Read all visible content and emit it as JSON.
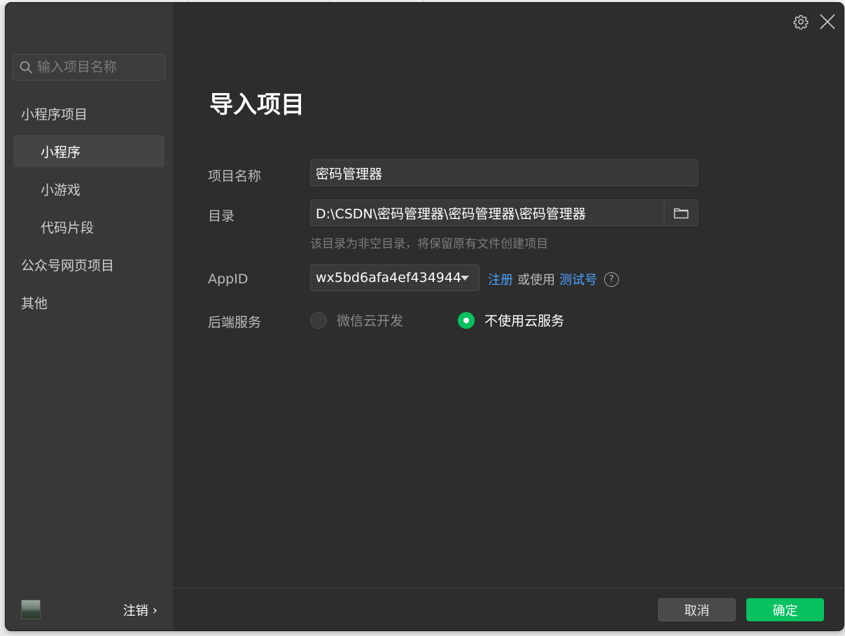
{
  "sidebar": {
    "search_placeholder": "输入项目名称",
    "groups": [
      {
        "label": "小程序项目"
      },
      {
        "label": "小程序"
      },
      {
        "label": "小游戏"
      },
      {
        "label": "代码片段"
      },
      {
        "label": "公众号网页项目"
      },
      {
        "label": "其他"
      }
    ],
    "footer": {
      "logout_label": "注销",
      "logout_arrow": "›"
    }
  },
  "main": {
    "title": "导入项目",
    "project_name": {
      "label": "项目名称",
      "value": "密码管理器"
    },
    "directory": {
      "label": "目录",
      "value": "D:\\CSDN\\密码管理器\\密码管理器\\密码管理器",
      "hint": "该目录为非空目录，将保留原有文件创建项目"
    },
    "appid": {
      "label": "AppID",
      "value": "wx5bd6afa4ef434944",
      "register_link": "注册",
      "or_use": "或使用",
      "test_link": "测试号",
      "help_glyph": "?"
    },
    "backend": {
      "label": "后端服务",
      "options": [
        {
          "label": "微信云开发",
          "checked": false
        },
        {
          "label": "不使用云服务",
          "checked": true
        }
      ]
    }
  },
  "footer": {
    "cancel_label": "取消",
    "confirm_label": "确定"
  },
  "colors": {
    "accent_green": "#07c160",
    "link_blue": "#4aa3ff",
    "sidebar_bg": "#383838",
    "main_bg": "#2d2d2d"
  }
}
